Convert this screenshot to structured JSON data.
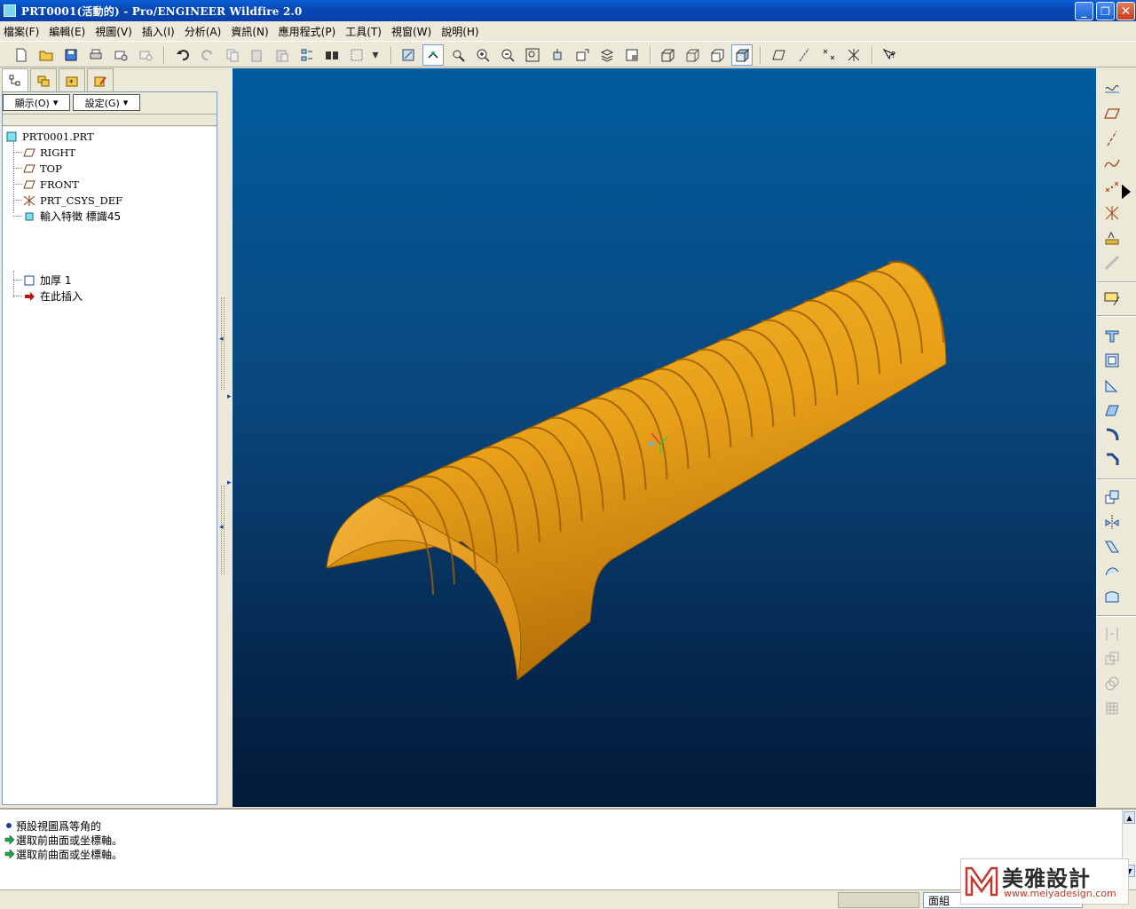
{
  "window": {
    "title": "PRT0001(活動的) - Pro/ENGINEER Wildfire 2.0",
    "minimize": "_",
    "maximize": "❐",
    "close": "✕"
  },
  "menubar": [
    "檔案(F)",
    "編輯(E)",
    "視圖(V)",
    "插入(I)",
    "分析(A)",
    "資訊(N)",
    "應用程式(P)",
    "工具(T)",
    "視窗(W)",
    "說明(H)"
  ],
  "toolbar": {
    "icons": [
      "new-icon",
      "open-icon",
      "save-icon",
      "print-icon",
      "mail-icon",
      "mail-attach-icon",
      "undo-icon",
      "redo-icon",
      "copy-icon",
      "paste-icon",
      "paste-special-icon",
      "regenerate-icon",
      "find-icon",
      "select-box-icon",
      "dropdown-icon",
      "repaint-icon",
      "spin-center-icon",
      "orient-mode-icon",
      "zoom-in-icon",
      "zoom-out-icon",
      "refit-icon",
      "reorient-icon",
      "saved-views-icon",
      "layers-icon",
      "view-manager-icon",
      "wireframe-icon",
      "hidden-line-icon",
      "no-hidden-icon",
      "shading-icon",
      "datum-planes-icon",
      "datum-axes-icon",
      "datum-points-icon",
      "coordinate-systems-icon",
      "context-help-icon"
    ]
  },
  "navigator": {
    "tabs": [
      "model-tree-tab",
      "folder-browser-tab",
      "favorites-tab",
      "connections-tab"
    ],
    "show_label": "顯示(O)",
    "settings_label": "設定(G)",
    "tree": {
      "root": "PRT0001.PRT",
      "items": [
        {
          "label": "RIGHT",
          "icon": "datum-plane-icon"
        },
        {
          "label": "TOP",
          "icon": "datum-plane-icon"
        },
        {
          "label": "FRONT",
          "icon": "datum-plane-icon"
        },
        {
          "label": "PRT_CSYS_DEF",
          "icon": "csys-icon"
        },
        {
          "label": "輸入特徵 標識45",
          "icon": "import-feature-icon"
        }
      ],
      "lower_items": [
        {
          "label": "加厚 1",
          "icon": "thicken-icon"
        },
        {
          "label": "在此插入",
          "icon": "insert-here-arrow-icon"
        }
      ]
    }
  },
  "right_toolbar": {
    "icons": [
      "datum-display-icon",
      "datum-plane-icon",
      "datum-axis-icon",
      "datum-curve-icon",
      "datum-point-icon",
      "coordinate-system-icon",
      "analysis-feature-icon",
      "sketch-icon",
      "hole-icon",
      "shell-icon",
      "rib-icon",
      "draft-icon",
      "round-icon",
      "chamfer-icon",
      "copy-feature-icon",
      "mirror-icon",
      "move-icon",
      "merge-icon",
      "trim-icon",
      "extend-icon",
      "offset-icon",
      "thicken-icon",
      "solidify-icon",
      "pattern-icon"
    ]
  },
  "messages": [
    {
      "icon": "info-bullet-icon",
      "text": "預設視圖爲等角的"
    },
    {
      "icon": "prompt-arrow-icon",
      "text": "選取前曲面或坐標軸。"
    },
    {
      "icon": "prompt-arrow-icon",
      "text": "選取前曲面或坐標軸。"
    }
  ],
  "statusbar": {
    "filter_value": "面組"
  },
  "watermark": {
    "chinese": "美雅設計",
    "url": "www.meiyadesign.com"
  },
  "colors": {
    "model_orange": "#e8a019",
    "viewport_top": "#015c9e",
    "viewport_bottom": "#031a38"
  }
}
